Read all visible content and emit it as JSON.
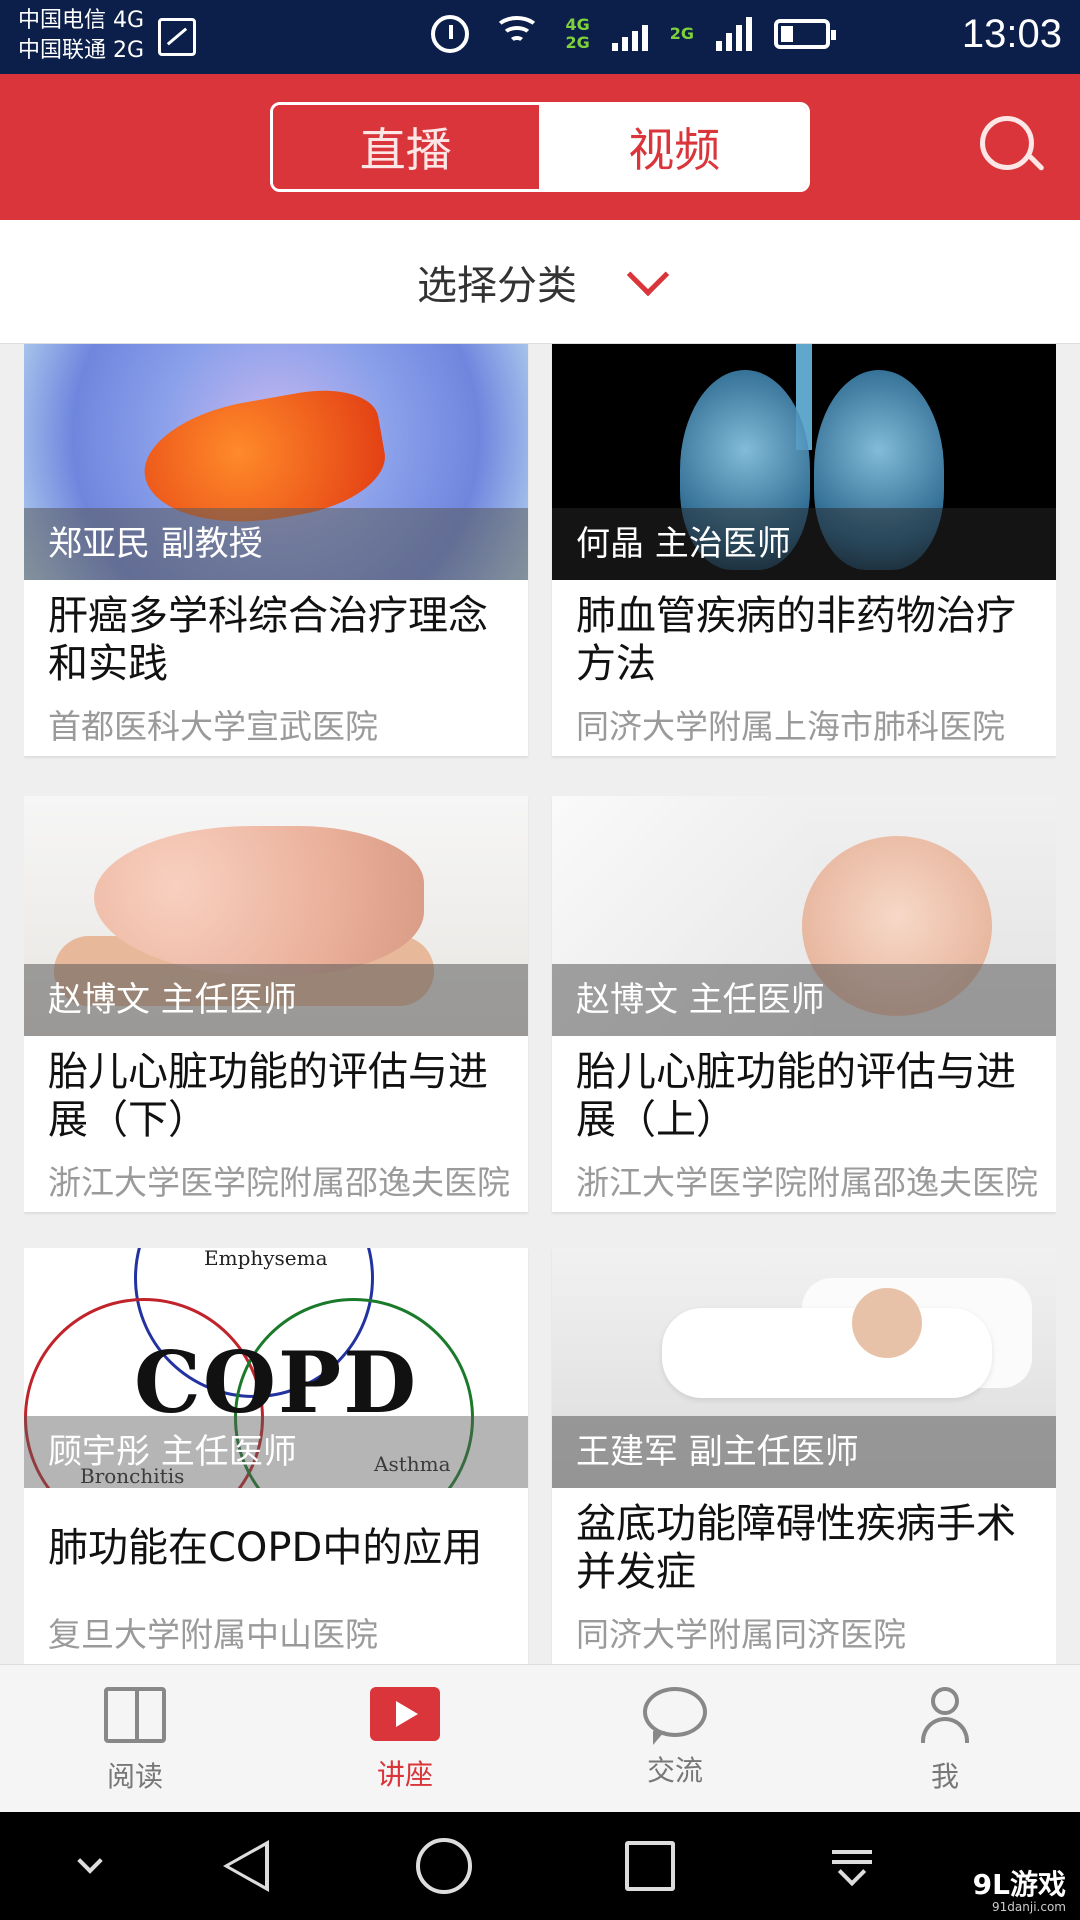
{
  "status_bar": {
    "carrier1": "中国电信 4G",
    "carrier2": "中国联通 2G",
    "net_top": "4G",
    "net_bottom": "2G",
    "net_right": "2G",
    "time": "13:03"
  },
  "header": {
    "tabs": [
      {
        "label": "直播",
        "active": false
      },
      {
        "label": "视频",
        "active": true
      }
    ],
    "search_icon": "search-icon",
    "accent_color": "#d9353b"
  },
  "category": {
    "label": "选择分类",
    "icon": "chevron-down-icon"
  },
  "videos": [
    {
      "doctor": "郑亚民 副教授",
      "title": "肝癌多学科综合治疗理念和实践",
      "hospital": "首都医科大学宣武医院"
    },
    {
      "doctor": "何晶 主治医师",
      "title": "肺血管疾病的非药物治疗方法",
      "hospital": "同济大学附属上海市肺科医院"
    },
    {
      "doctor": "赵博文 主任医师",
      "title": "胎儿心脏功能的评估与进展（下）",
      "hospital": "浙江大学医学院附属邵逸夫医院"
    },
    {
      "doctor": "赵博文 主任医师",
      "title": "胎儿心脏功能的评估与进展（上）",
      "hospital": "浙江大学医学院附属邵逸夫医院"
    },
    {
      "doctor": "顾宇彤 主任医师",
      "title": "肺功能在COPD中的应用",
      "hospital": "复旦大学附属中山医院",
      "image_text": {
        "main": "COPD",
        "top": "Emphysema",
        "left": "Bronchitis",
        "right": "Asthma"
      }
    },
    {
      "doctor": "王建军 副主任医师",
      "title": "盆底功能障碍性疾病手术并发症",
      "hospital": "同济大学附属同济医院"
    }
  ],
  "bottom_nav": [
    {
      "label": "阅读",
      "icon": "book-icon",
      "active": false
    },
    {
      "label": "讲座",
      "icon": "video-icon",
      "active": true
    },
    {
      "label": "交流",
      "icon": "chat-icon",
      "active": false
    },
    {
      "label": "我",
      "icon": "user-icon",
      "active": false
    }
  ],
  "watermark": {
    "brand": "9L游戏",
    "url": "91danji.com"
  }
}
